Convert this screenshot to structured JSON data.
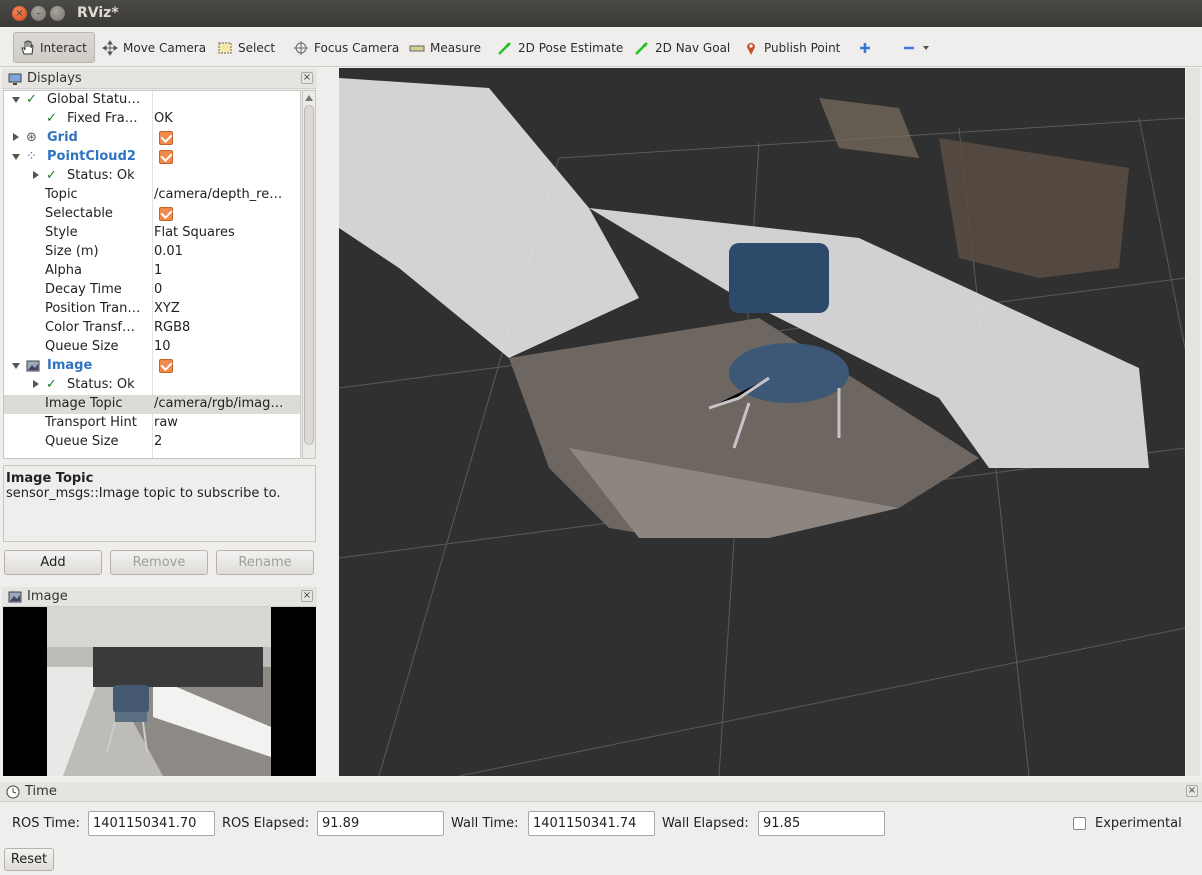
{
  "window": {
    "title": "RViz*"
  },
  "toolbar": {
    "tools": [
      {
        "label": "Interact",
        "icon": "hand-icon"
      },
      {
        "label": "Move Camera",
        "icon": "move-icon"
      },
      {
        "label": "Select",
        "icon": "select-rect-icon"
      },
      {
        "label": "Focus Camera",
        "icon": "crosshair-icon"
      },
      {
        "label": "Measure",
        "icon": "ruler-icon"
      },
      {
        "label": "2D Pose Estimate",
        "icon": "green-arrow-icon"
      },
      {
        "label": "2D Nav Goal",
        "icon": "green-arrow-icon"
      },
      {
        "label": "Publish Point",
        "icon": "pin-icon"
      }
    ]
  },
  "displays": {
    "title": "Displays",
    "rows": [
      {
        "name": "Global Statu…",
        "value": ""
      },
      {
        "name": "Fixed Fra…",
        "value": "OK"
      },
      {
        "name": "Grid",
        "value": ""
      },
      {
        "name": "PointCloud2",
        "value": ""
      },
      {
        "name": "Status: Ok",
        "value": ""
      },
      {
        "name": "Topic",
        "value": "/camera/depth_re…"
      },
      {
        "name": "Selectable",
        "value": ""
      },
      {
        "name": "Style",
        "value": "Flat Squares"
      },
      {
        "name": "Size (m)",
        "value": "0.01"
      },
      {
        "name": "Alpha",
        "value": "1"
      },
      {
        "name": "Decay Time",
        "value": "0"
      },
      {
        "name": "Position Tran…",
        "value": "XYZ"
      },
      {
        "name": "Color Transf…",
        "value": "RGB8"
      },
      {
        "name": "Queue Size",
        "value": "10"
      },
      {
        "name": "Image",
        "value": ""
      },
      {
        "name": "Status: Ok",
        "value": ""
      },
      {
        "name": "Image Topic",
        "value": "/camera/rgb/imag…"
      },
      {
        "name": "Transport Hint",
        "value": "raw"
      },
      {
        "name": "Queue Size",
        "value": "2"
      }
    ],
    "description_title": "Image Topic",
    "description_text": "sensor_msgs::Image topic to subscribe to.",
    "add_label": "Add",
    "remove_label": "Remove",
    "rename_label": "Rename"
  },
  "image_panel": {
    "title": "Image"
  },
  "time": {
    "title": "Time",
    "ros_time_label": "ROS Time:",
    "ros_time": "1401150341.70",
    "ros_elapsed_label": "ROS Elapsed:",
    "ros_elapsed": "91.89",
    "wall_time_label": "Wall Time:",
    "wall_time": "1401150341.74",
    "wall_elapsed_label": "Wall Elapsed:",
    "wall_elapsed": "91.85",
    "experimental_label": "Experimental",
    "reset_label": "Reset"
  },
  "colors": {
    "checkbox": "#f08a4b",
    "blue_label": "#2f74c0",
    "viewport_bg": "#303030"
  }
}
